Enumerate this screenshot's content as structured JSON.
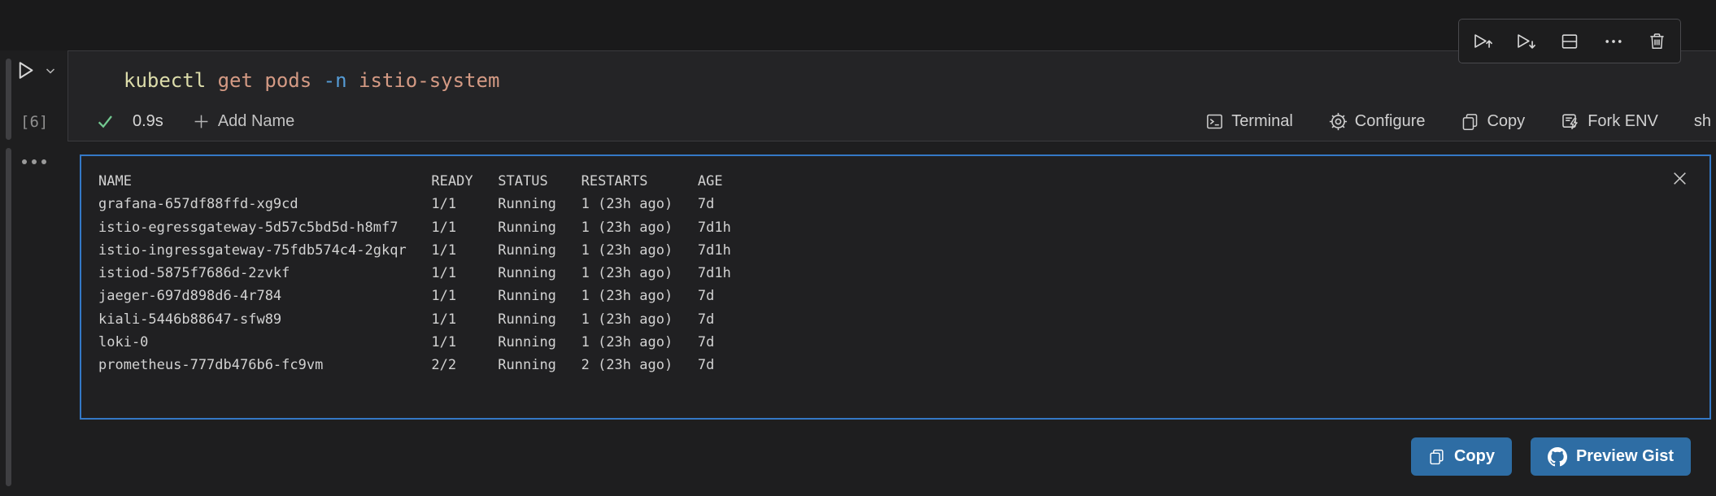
{
  "cell": {
    "execution_label": "[6]",
    "command_tokens": [
      {
        "text": "kubectl ",
        "color": "#dcdcaa"
      },
      {
        "text": "get pods ",
        "color": "#d49a84"
      },
      {
        "text": "-n ",
        "color": "#569cd6"
      },
      {
        "text": "istio-system",
        "color": "#d49a84"
      }
    ],
    "status": {
      "duration": "0.9s",
      "add_name_label": "Add Name"
    },
    "actions": [
      {
        "label": "Terminal"
      },
      {
        "label": "Configure"
      },
      {
        "label": "Copy"
      },
      {
        "label": "Fork ENV"
      },
      {
        "label": "sh"
      }
    ]
  },
  "toolbar_icons": [
    "run-above-icon",
    "run-below-icon",
    "split-cell-icon",
    "more-icon",
    "trash-icon"
  ],
  "output": {
    "columns": [
      "NAME",
      "READY",
      "STATUS",
      "RESTARTS",
      "AGE"
    ],
    "rows": [
      [
        "grafana-657df88ffd-xg9cd",
        "1/1",
        "Running",
        "1 (23h ago)",
        "7d"
      ],
      [
        "istio-egressgateway-5d57c5bd5d-h8mf7",
        "1/1",
        "Running",
        "1 (23h ago)",
        "7d1h"
      ],
      [
        "istio-ingressgateway-75fdb574c4-2gkqr",
        "1/1",
        "Running",
        "1 (23h ago)",
        "7d1h"
      ],
      [
        "istiod-5875f7686d-2zvkf",
        "1/1",
        "Running",
        "1 (23h ago)",
        "7d1h"
      ],
      [
        "jaeger-697d898d6-4r784",
        "1/1",
        "Running",
        "1 (23h ago)",
        "7d"
      ],
      [
        "kiali-5446b88647-sfw89",
        "1/1",
        "Running",
        "1 (23h ago)",
        "7d"
      ],
      [
        "loki-0",
        "1/1",
        "Running",
        "1 (23h ago)",
        "7d"
      ],
      [
        "prometheus-777db476b6-fc9vm",
        "2/2",
        "Running",
        "2 (23h ago)",
        "7d"
      ]
    ]
  },
  "footer": {
    "copy_label": "Copy",
    "preview_gist_label": "Preview Gist"
  },
  "colors": {
    "accent_blue": "#3478c6",
    "button_blue": "#2e6da4",
    "success_green": "#73c991",
    "editor_bg": "#242426",
    "output_bg": "#202022"
  }
}
